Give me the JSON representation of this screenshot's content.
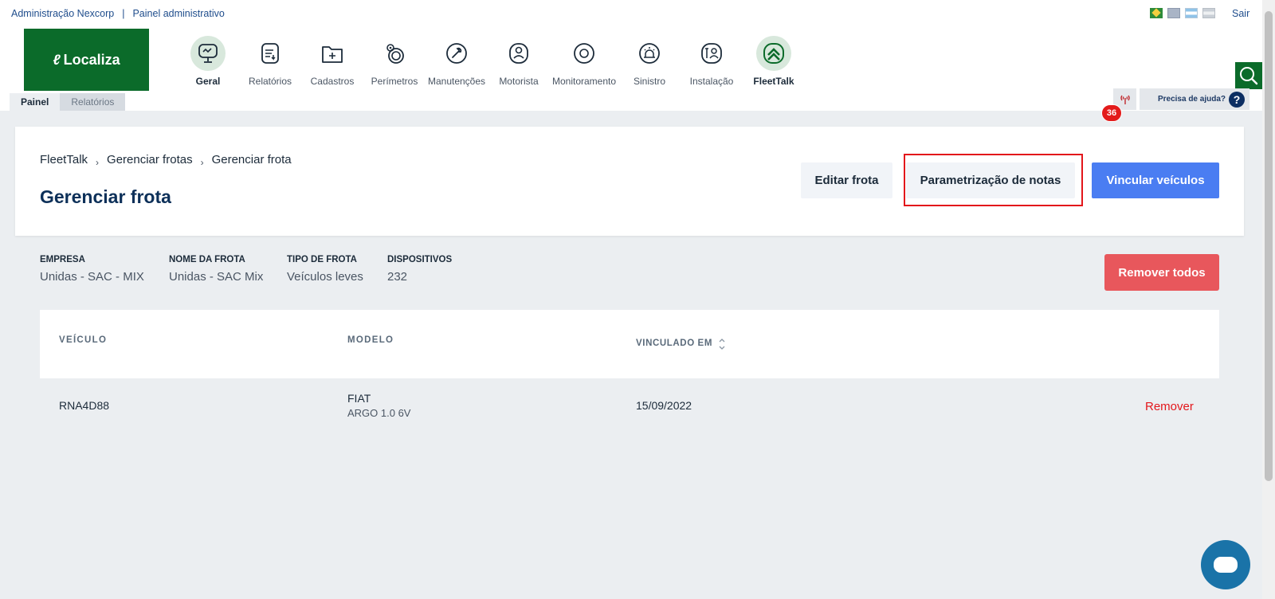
{
  "header": {
    "admin_link": "Administração Nexcorp",
    "separator": "|",
    "panel_link": "Painel administrativo",
    "logout": "Sair",
    "logo_text": "Localiza",
    "brand_color": "#0b6b2a"
  },
  "nav": {
    "items": [
      {
        "label": "Geral",
        "icon": "monitor-chart-icon"
      },
      {
        "label": "Relatórios",
        "icon": "report-icon"
      },
      {
        "label": "Cadastros",
        "icon": "folder-add-icon"
      },
      {
        "label": "Perímetros",
        "icon": "perimeter-icon"
      },
      {
        "label": "Manutenções",
        "icon": "wrench-icon"
      },
      {
        "label": "Motorista",
        "icon": "driver-icon"
      },
      {
        "label": "Monitoramento",
        "icon": "monitor-circle-icon"
      },
      {
        "label": "Sinistro",
        "icon": "siren-icon"
      },
      {
        "label": "Instalação",
        "icon": "installer-icon"
      },
      {
        "label": "FleetTalk",
        "icon": "fleettalk-icon"
      }
    ]
  },
  "tabs": [
    {
      "label": "Painel"
    },
    {
      "label": "Relatórios"
    }
  ],
  "alerts": {
    "count": "36",
    "help_text": "Precisa de ajuda?",
    "help_icon": "?"
  },
  "breadcrumb": {
    "items": [
      "FleetTalk",
      "Gerenciar frotas",
      "Gerenciar frota"
    ],
    "separator": "›"
  },
  "page": {
    "title": "Gerenciar frota"
  },
  "actions": {
    "edit": "Editar frota",
    "notes": "Parametrização de notas",
    "link": "Vincular veículos",
    "remove_all": "Remover todos",
    "link_color": "#4a7df2",
    "remove_color": "#e8575c"
  },
  "fleet_info": {
    "company_label": "EMPRESA",
    "company": "Unidas - SAC - MIX",
    "name_label": "NOME DA FROTA",
    "name": "Unidas - SAC Mix",
    "type_label": "TIPO DE FROTA",
    "type": "Veículos leves",
    "devices_label": "DISPOSITIVOS",
    "devices": "232"
  },
  "table": {
    "columns": [
      "VEÍCULO",
      "MODELO",
      "VINCULADO EM"
    ],
    "rows": [
      {
        "vehicle": "RNA4D88",
        "brand": "FIAT",
        "model": "ARGO 1.0 6V",
        "linked_at": "15/09/2022",
        "action": "Remover"
      }
    ]
  }
}
